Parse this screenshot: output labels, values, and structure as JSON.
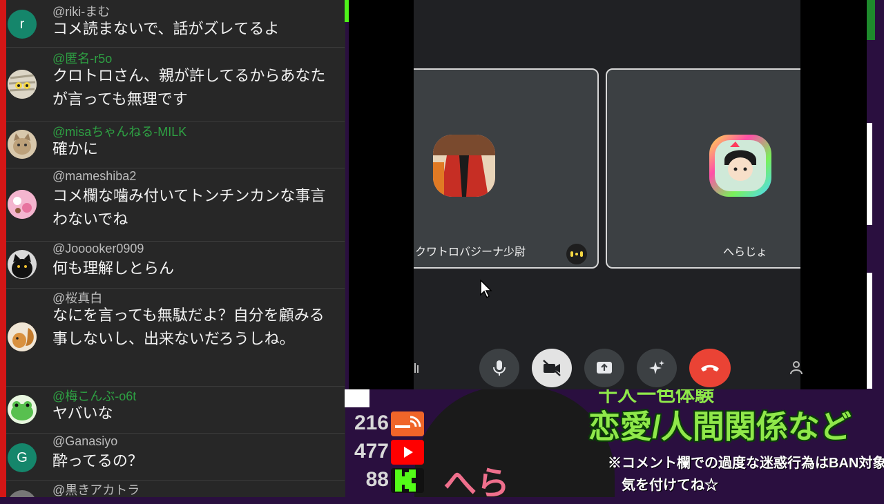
{
  "chat": {
    "messages": [
      {
        "author": "@riki-まむ",
        "text": "コメ読まないで、話がズレてるよ",
        "avatar_letter": "r",
        "avatar_color": "#15866b",
        "member": false
      },
      {
        "author": "@匿名-r5o",
        "text": "クロトロさん、親が許してるからあなたが言っても無理です",
        "avatar_letter": "",
        "avatar_color": "#d9d3c2",
        "member": true
      },
      {
        "author": "@misaちゃんねる-MILK",
        "text": "確かに",
        "avatar_letter": "",
        "avatar_color": "#c8b59a",
        "member": true
      },
      {
        "author": "@mameshiba2",
        "text": "コメ欄な噛み付いてトンチンカンな事言わないでね",
        "avatar_letter": "",
        "avatar_color": "#f2a2c4",
        "member": false
      },
      {
        "author": "@Jooooker0909",
        "text": "何も理解しとらん",
        "avatar_letter": "",
        "avatar_color": "#151515",
        "member": false
      },
      {
        "author": "@桜真白",
        "text": "なにを言っても無駄だよ？自分を顧みる事しないし、出来ないだろうしね。",
        "avatar_letter": "",
        "avatar_color": "#c98b3c",
        "member": false
      },
      {
        "author": "@梅こんぶ-o6t",
        "text": "ヤバいな",
        "avatar_letter": "",
        "avatar_color": "#5cc25a",
        "member": true
      },
      {
        "author": "@Ganasiyo",
        "text": "酔ってるの？",
        "avatar_letter": "G",
        "avatar_color": "#15866b",
        "member": false
      },
      {
        "author": "@黒きアカトラ",
        "text": "",
        "avatar_letter": "",
        "avatar_color": "#777777",
        "member": false
      }
    ]
  },
  "call": {
    "participants": [
      {
        "name": "クワトロバジーナ少尉",
        "speaking": true
      },
      {
        "name": "へらじょ",
        "speaking": false
      }
    ],
    "controls": [
      {
        "id": "mic",
        "icon": "mic-icon"
      },
      {
        "id": "camera",
        "icon": "camera-off-icon"
      },
      {
        "id": "present",
        "icon": "present-icon"
      },
      {
        "id": "effects",
        "icon": "sparkle-icon"
      },
      {
        "id": "hangup",
        "icon": "hangup-icon"
      }
    ]
  },
  "stream": {
    "stats": [
      {
        "platform": "rss-icon",
        "count": "216"
      },
      {
        "platform": "youtube-icon",
        "count": "477"
      },
      {
        "platform": "kick-icon",
        "count": "88"
      }
    ],
    "banner": {
      "line_top": "十人一色体験",
      "line_main": "恋愛/人間関係など",
      "notice_1": "※コメント欄での過度な迷惑行為はBAN対象",
      "notice_2": "気を付けてね☆"
    },
    "streamer_label": "へら",
    "colors": {
      "accent_green": "#4ef21a",
      "banner_yellow": "#ffe800",
      "youtube_red": "#ff0000",
      "kick_green": "#53fc18"
    }
  }
}
